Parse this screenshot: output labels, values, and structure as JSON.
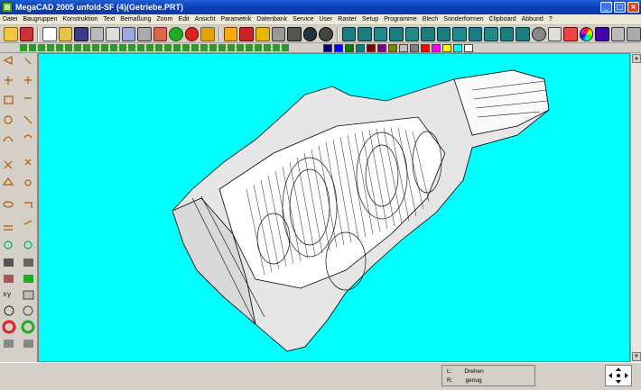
{
  "window": {
    "title": "MegaCAD 2005 unfold-SF (4)(Getriebe.PRT)",
    "minimize_label": "_",
    "maximize_label": "□",
    "close_label": "×"
  },
  "menu": {
    "items": [
      "Datei",
      "Baugruppen",
      "Konstruktion",
      "Text",
      "Bemaßung",
      "Zoom",
      "Edit",
      "Ansicht",
      "Parametrik",
      "Datenbank",
      "Service",
      "User",
      "Raster",
      "Setup",
      "Programme",
      "Blech",
      "Sonderformen",
      "Clipboard",
      "Abbund",
      "?"
    ]
  },
  "status": {
    "left_key": "L:",
    "left_value": "Drehen",
    "right_key": "R:",
    "right_value": "genug"
  },
  "colors": {
    "canvas_bg": "#00ffff",
    "titlebar": "#0a3fb8",
    "swatches": [
      "#000080",
      "#0000ff",
      "#008000",
      "#008080",
      "#800000",
      "#800080",
      "#808000",
      "#c0c0c0",
      "#808080",
      "#ff0000"
    ]
  },
  "icons": {
    "toolbar": [
      "envelope-icon",
      "grid-icon",
      "new-file-icon",
      "open-folder-icon",
      "save-icon",
      "print-icon",
      "zoom-icon",
      "image-icon",
      "render-icon",
      "pen-icon",
      "redo-icon",
      "g-icon",
      "rotate-icon",
      "move-icon",
      "axes-icon",
      "layers-icon",
      "color-wheel-icon",
      "solid-box-icon",
      "help-icon"
    ]
  }
}
